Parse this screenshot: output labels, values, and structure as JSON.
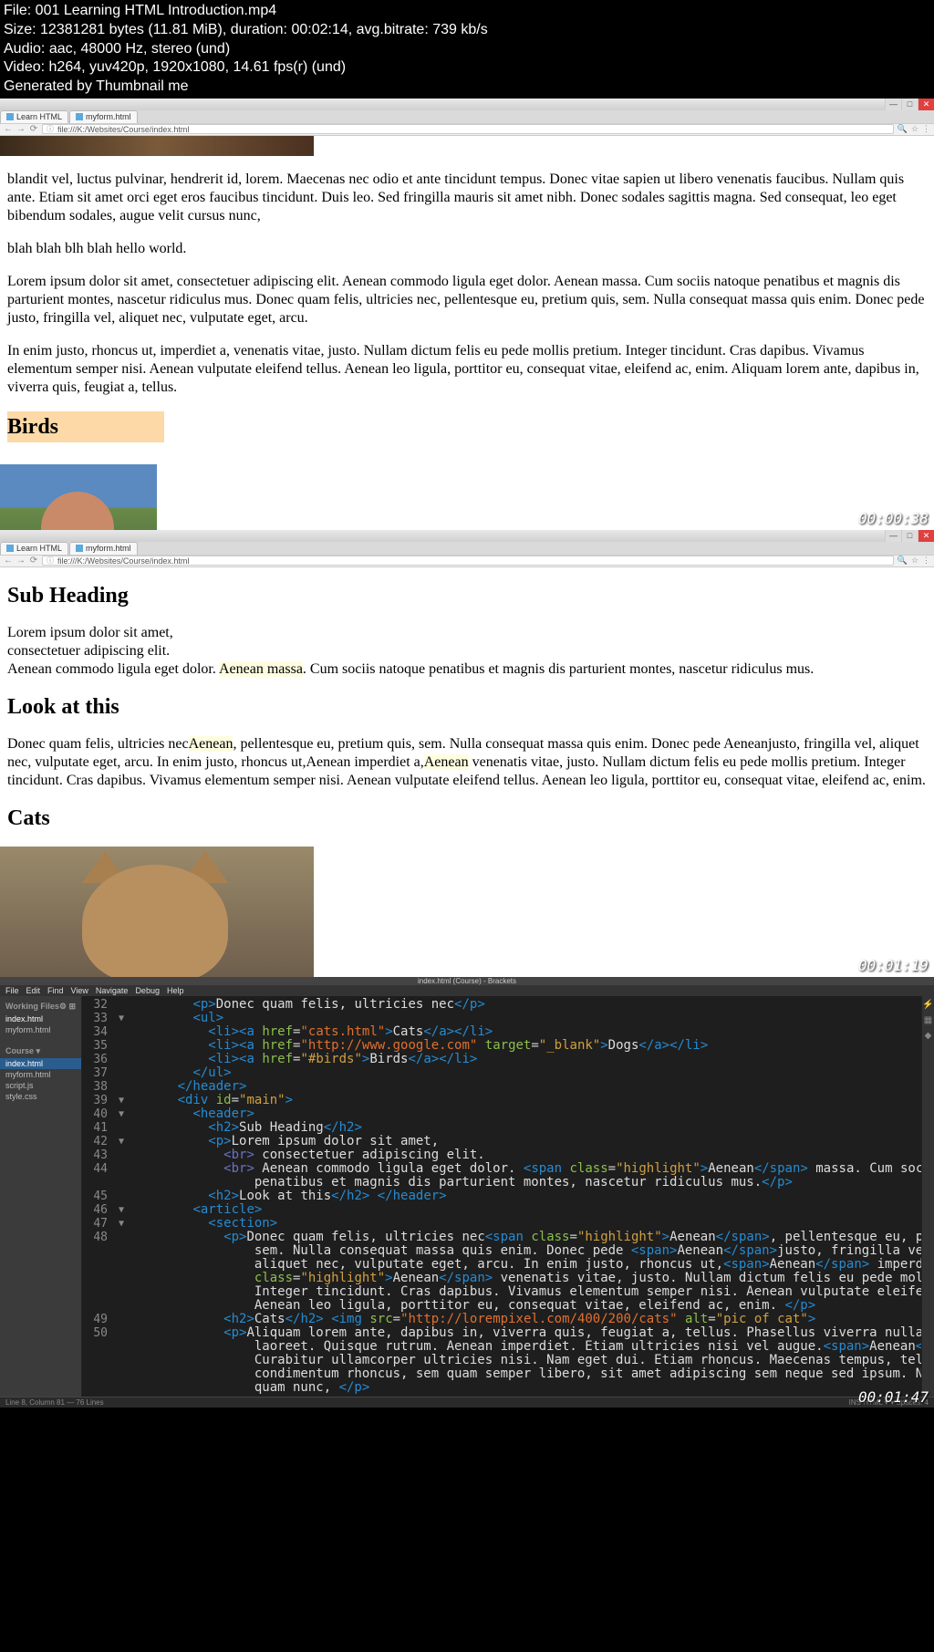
{
  "file_info": {
    "line1": "File: 001 Learning HTML Introduction.mp4",
    "line2": "Size: 12381281 bytes (11.81 MiB), duration: 00:02:14, avg.bitrate: 739 kb/s",
    "line3": "Audio: aac, 48000 Hz, stereo (und)",
    "line4": "Video: h264, yuv420p, 1920x1080, 14.61 fps(r) (und)",
    "line5": "Generated by Thumbnail me"
  },
  "browser1": {
    "tabs": [
      "Learn HTML",
      "myform.html"
    ],
    "url": "file:///K:/Websites/Course/index.html",
    "timestamp": "00:00:38",
    "para1": "blandit vel, luctus pulvinar, hendrerit id, lorem. Maecenas nec odio et ante tincidunt tempus. Donec vitae sapien ut libero venenatis faucibus. Nullam quis ante. Etiam sit amet orci eget eros faucibus tincidunt. Duis leo. Sed fringilla mauris sit amet nibh. Donec sodales sagittis magna. Sed consequat, leo eget bibendum sodales, augue velit cursus nunc,",
    "para2": "blah blah blh blah hello world.",
    "para3": "Lorem ipsum dolor sit amet, consectetuer adipiscing elit. Aenean commodo ligula eget dolor. Aenean massa. Cum sociis natoque penatibus et magnis dis parturient montes, nascetur ridiculus mus. Donec quam felis, ultricies nec, pellentesque eu, pretium quis, sem. Nulla consequat massa quis enim. Donec pede justo, fringilla vel, aliquet nec, vulputate eget, arcu.",
    "para4": "In enim justo, rhoncus ut, imperdiet a, venenatis vitae, justo. Nullam dictum felis eu pede mollis pretium. Integer tincidunt. Cras dapibus. Vivamus elementum semper nisi. Aenean vulputate eleifend tellus. Aenean leo ligula, porttitor eu, consequat vitae, eleifend ac, enim. Aliquam lorem ante, dapibus in, viverra quis, feugiat a, tellus.",
    "heading_birds": "Birds"
  },
  "browser2": {
    "tabs": [
      "Learn HTML",
      "myform.html"
    ],
    "url": "file:///K:/Websites/Course/index.html",
    "timestamp": "00:01:19",
    "h_sub": "Sub Heading",
    "sub_p1a": "Lorem ipsum dolor sit amet,",
    "sub_p1b": "consectetuer adipiscing elit.",
    "sub_p1c_pre": "Aenean commodo ligula eget dolor. ",
    "sub_p1c_hl": "Aenean massa",
    "sub_p1c_post": ". Cum sociis natoque penatibus et magnis dis parturient montes, nascetur ridiculus mus.",
    "h_look": "Look at this",
    "look_p_a": "Donec quam felis, ultricies nec",
    "look_hl1": "Aenean",
    "look_p_b": ", pellentesque eu, pretium quis, sem. Nulla consequat massa quis enim. Donec pede Aeneanjusto, fringilla vel, aliquet nec, vulputate eget, arcu. In enim justo, rhoncus ut,Aenean imperdiet a,",
    "look_hl2": "Aenean",
    "look_p_c": " venenatis vitae, justo. Nullam dictum felis eu pede mollis pretium. Integer tincidunt. Cras dapibus. Vivamus elementum semper nisi. Aenean vulputate eleifend tellus. Aenean leo ligula, porttitor eu, consequat vitae, eleifend ac, enim.",
    "h_cats": "Cats"
  },
  "editor": {
    "title": "index.html (Course) - Brackets",
    "menu": [
      "File",
      "Edit",
      "Find",
      "View",
      "Navigate",
      "Debug",
      "Help"
    ],
    "sidebar": {
      "working_header": "Working Files",
      "working": [
        "index.html",
        "myform.html"
      ],
      "project_header": "Course ▾",
      "project": [
        "index.html",
        "myform.html",
        "script.js",
        "style.css"
      ]
    },
    "status_left": "Line 8, Column 81 — 76 Lines",
    "status_right": "INS   HTML ▾   ▾ Spaces: 4",
    "timestamp": "00:01:47",
    "code": [
      {
        "n": "32",
        "f": "",
        "html": "        <span class='t-tag'>&lt;p&gt;</span><span class='t-text'>Donec quam felis, ultricies nec</span><span class='t-tag'>&lt;/p&gt;</span>"
      },
      {
        "n": "33",
        "f": "▼",
        "html": "        <span class='t-tag'>&lt;ul&gt;</span>"
      },
      {
        "n": "34",
        "f": "",
        "html": "          <span class='t-tag'>&lt;li&gt;&lt;a</span> <span class='t-attr'>href</span>=<span class='t-str'>\"cats.html\"</span><span class='t-tag'>&gt;</span><span class='t-text'>Cats</span><span class='t-tag'>&lt;/a&gt;&lt;/li&gt;</span>"
      },
      {
        "n": "35",
        "f": "",
        "html": "          <span class='t-tag'>&lt;li&gt;&lt;a</span> <span class='t-attr'>href</span>=<span class='t-str'>\"http://www.google.com\"</span> <span class='t-attr'>target</span>=<span class='t-str2'>\"_blank\"</span><span class='t-tag'>&gt;</span><span class='t-text'>Dogs</span><span class='t-tag'>&lt;/a&gt;&lt;/li&gt;</span>"
      },
      {
        "n": "36",
        "f": "",
        "html": "          <span class='t-tag'>&lt;li&gt;&lt;a</span> <span class='t-attr'>href</span>=<span class='t-str2'>\"#birds\"</span><span class='t-tag'>&gt;</span><span class='t-text'>Birds</span><span class='t-tag'>&lt;/a&gt;&lt;/li&gt;</span>"
      },
      {
        "n": "37",
        "f": "",
        "html": "        <span class='t-tag'>&lt;/ul&gt;</span>"
      },
      {
        "n": "38",
        "f": "",
        "html": "      <span class='t-tag'>&lt;/header&gt;</span>"
      },
      {
        "n": "39",
        "f": "▼",
        "html": "      <span class='t-tag'>&lt;div</span> <span class='t-attr'>id</span>=<span class='t-str2'>\"main\"</span><span class='t-tag'>&gt;</span>"
      },
      {
        "n": "40",
        "f": "▼",
        "html": "        <span class='t-tag'>&lt;header&gt;</span>"
      },
      {
        "n": "41",
        "f": "",
        "html": "          <span class='t-tag'>&lt;h2&gt;</span><span class='t-text'>Sub Heading</span><span class='t-tag'>&lt;/h2&gt;</span>"
      },
      {
        "n": "42",
        "f": "▼",
        "html": "          <span class='t-tag'>&lt;p&gt;</span><span class='t-text'>Lorem ipsum dolor sit amet,</span>"
      },
      {
        "n": "43",
        "f": "",
        "html": "            <span class='t-br'>&lt;br&gt;</span><span class='t-text'> consectetuer adipiscing elit.</span>"
      },
      {
        "n": "44",
        "f": "",
        "html": "            <span class='t-br'>&lt;br&gt;</span><span class='t-text'> Aenean commodo ligula eget dolor. </span><span class='t-tag'>&lt;span</span> <span class='t-attr'>class</span>=<span class='t-str2'>\"highlight\"</span><span class='t-tag'>&gt;</span><span class='t-text'>Aenean</span><span class='t-tag'>&lt;/span&gt;</span><span class='t-text'> massa. Cum sociis natoque</span>"
      },
      {
        "n": "",
        "f": "",
        "html": "                <span class='t-text'>penatibus et magnis dis parturient montes, nascetur ridiculus mus.</span><span class='t-tag'>&lt;/p&gt;</span>"
      },
      {
        "n": "45",
        "f": "",
        "html": "          <span class='t-tag'>&lt;h2&gt;</span><span class='t-text'>Look at this</span><span class='t-tag'>&lt;/h2&gt;</span> <span class='t-tag'>&lt;/header&gt;</span>"
      },
      {
        "n": "46",
        "f": "▼",
        "html": "        <span class='t-tag'>&lt;article&gt;</span>"
      },
      {
        "n": "47",
        "f": "▼",
        "html": "          <span class='t-tag'>&lt;section&gt;</span>"
      },
      {
        "n": "48",
        "f": "",
        "html": "            <span class='t-tag'>&lt;p&gt;</span><span class='t-text'>Donec quam felis, ultricies nec</span><span class='t-tag'>&lt;span</span> <span class='t-attr'>class</span>=<span class='t-str2'>\"highlight\"</span><span class='t-tag'>&gt;</span><span class='t-text'>Aenean</span><span class='t-tag'>&lt;/span&gt;</span><span class='t-text'>, pellentesque eu, pretium quis,</span>"
      },
      {
        "n": "",
        "f": "",
        "html": "                <span class='t-text'>sem. Nulla consequat massa quis enim. Donec pede </span><span class='t-tag'>&lt;span&gt;</span><span class='t-text'>Aenean</span><span class='t-tag'>&lt;/span&gt;</span><span class='t-text'>justo, fringilla vel,</span>"
      },
      {
        "n": "",
        "f": "",
        "html": "                <span class='t-text'>aliquet nec, vulputate eget, arcu. In enim justo, rhoncus ut,</span><span class='t-tag'>&lt;span&gt;</span><span class='t-text'>Aenean</span><span class='t-tag'>&lt;/span&gt;</span><span class='t-text'> imperdiet a,</span><span class='t-tag'>&lt;span</span>"
      },
      {
        "n": "",
        "f": "",
        "html": "                <span class='t-attr'>class</span>=<span class='t-str2'>\"highlight\"</span><span class='t-tag'>&gt;</span><span class='t-text'>Aenean</span><span class='t-tag'>&lt;/span&gt;</span><span class='t-text'> venenatis vitae, justo. Nullam dictum felis eu pede mollis pretium.</span>"
      },
      {
        "n": "",
        "f": "",
        "html": "                <span class='t-text'>Integer tincidunt. Cras dapibus. Vivamus elementum semper nisi. Aenean vulputate eleifend tellus.</span>"
      },
      {
        "n": "",
        "f": "",
        "html": "                <span class='t-text'>Aenean leo ligula, porttitor eu, consequat vitae, eleifend ac, enim. </span><span class='t-tag'>&lt;/p&gt;</span>"
      },
      {
        "n": "49",
        "f": "",
        "html": "            <span class='t-tag'>&lt;h2&gt;</span><span class='t-text'>Cats</span><span class='t-tag'>&lt;/h2&gt;</span> <span class='t-tag'>&lt;img</span> <span class='t-attr'>src</span>=<span class='t-str'>\"http://lorempixel.com/400/200/cats\"</span> <span class='t-attr'>alt</span>=<span class='t-str2'>\"pic of cat\"</span><span class='t-tag'>&gt;</span>"
      },
      {
        "n": "50",
        "f": "",
        "html": "            <span class='t-tag'>&lt;p&gt;</span><span class='t-text'>Aliquam lorem ante, dapibus in, viverra quis, feugiat a, tellus. Phasellus viverra nulla ut metus varius</span>"
      },
      {
        "n": "",
        "f": "",
        "html": "                <span class='t-text'>laoreet. Quisque rutrum. Aenean imperdiet. Etiam ultricies nisi vel augue.</span><span class='t-tag'>&lt;span&gt;</span><span class='t-text'>Aenean</span><span class='t-tag'>&lt;/span&gt;</span>"
      },
      {
        "n": "",
        "f": "",
        "html": "                <span class='t-text'>Curabitur ullamcorper ultricies nisi. Nam eget dui. Etiam rhoncus. Maecenas tempus, tellus eget</span>"
      },
      {
        "n": "",
        "f": "",
        "html": "                <span class='t-text'>condimentum rhoncus, sem quam semper libero, sit amet adipiscing sem neque sed ipsum. Nam</span>"
      },
      {
        "n": "",
        "f": "",
        "html": "                <span class='t-text'>quam nunc, </span><span class='t-tag'>&lt;/p&gt;</span>"
      }
    ]
  }
}
